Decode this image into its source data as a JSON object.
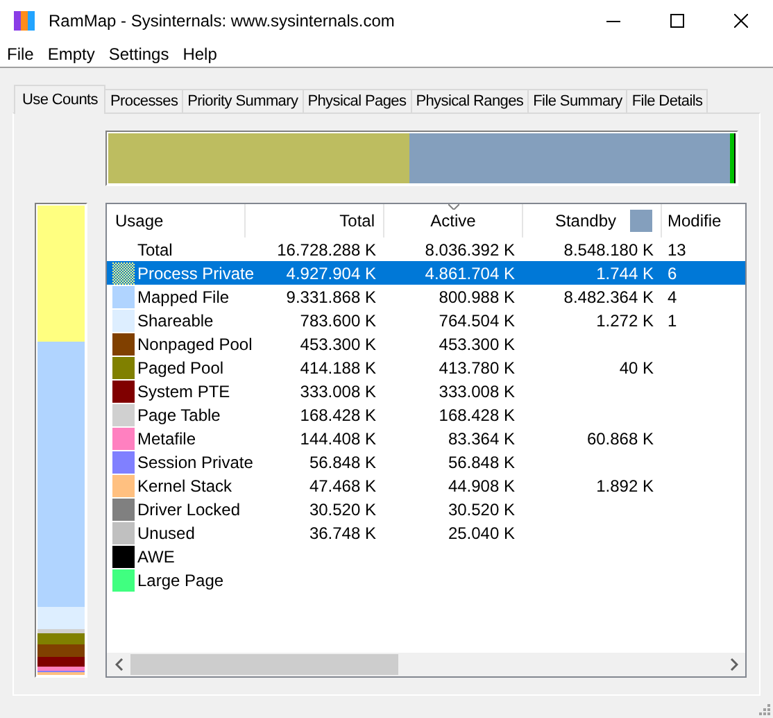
{
  "window": {
    "title": "RamMap - Sysinternals: www.sysinternals.com"
  },
  "menu": [
    "File",
    "Empty",
    "Settings",
    "Help"
  ],
  "tabs": [
    {
      "label": "Use Counts",
      "selected": true
    },
    {
      "label": "Processes",
      "selected": false
    },
    {
      "label": "Priority Summary",
      "selected": false
    },
    {
      "label": "Physical Pages",
      "selected": false
    },
    {
      "label": "Physical Ranges",
      "selected": false
    },
    {
      "label": "File Summary",
      "selected": false
    },
    {
      "label": "File Details",
      "selected": false
    }
  ],
  "table": {
    "columns": [
      {
        "label": "Usage",
        "sorted": false
      },
      {
        "label": "Total",
        "sorted": false
      },
      {
        "label": "Active",
        "sorted": true
      },
      {
        "label": "Standby",
        "sorted": false,
        "color": "#849fbd"
      },
      {
        "label": "Modifie",
        "sorted": false
      }
    ],
    "rows": [
      {
        "usage": "Total",
        "total": "16.728.288 K",
        "active": "8.036.392 K",
        "standby": "8.548.180 K",
        "modified": "13",
        "selected": false
      },
      {
        "usage": "Process Private",
        "color": "#ffff80",
        "total": "4.927.904 K",
        "active": "4.861.704 K",
        "standby": "1.744 K",
        "modified": "6",
        "selected": true
      },
      {
        "usage": "Mapped File",
        "color": "#b0d4ff",
        "total": "9.331.868 K",
        "active": "800.988 K",
        "standby": "8.482.364 K",
        "modified": "4",
        "selected": false
      },
      {
        "usage": "Shareable",
        "color": "#ddeeff",
        "total": "783.600 K",
        "active": "764.504 K",
        "standby": "1.272 K",
        "modified": "1",
        "selected": false
      },
      {
        "usage": "Nonpaged Pool",
        "color": "#804000",
        "total": "453.300 K",
        "active": "453.300 K",
        "selected": false
      },
      {
        "usage": "Paged Pool",
        "color": "#808000",
        "total": "414.188 K",
        "active": "413.780 K",
        "standby": "40 K",
        "selected": false
      },
      {
        "usage": "System PTE",
        "color": "#800000",
        "total": "333.008 K",
        "active": "333.008 K",
        "selected": false
      },
      {
        "usage": "Page Table",
        "color": "#d0d0d0",
        "total": "168.428 K",
        "active": "168.428 K",
        "selected": false
      },
      {
        "usage": "Metafile",
        "color": "#ff80c0",
        "total": "144.408 K",
        "active": "83.364 K",
        "standby": "60.868 K",
        "selected": false
      },
      {
        "usage": "Session Private",
        "color": "#8080ff",
        "total": "56.848 K",
        "active": "56.848 K",
        "selected": false
      },
      {
        "usage": "Kernel Stack",
        "color": "#ffc080",
        "total": "47.468 K",
        "active": "44.908 K",
        "standby": "1.892 K",
        "selected": false
      },
      {
        "usage": "Driver Locked",
        "color": "#808080",
        "total": "30.520 K",
        "active": "30.520 K",
        "selected": false
      },
      {
        "usage": "Unused",
        "color": "#c0c0c0",
        "total": "36.748 K",
        "active": "25.040 K",
        "selected": false
      },
      {
        "usage": "AWE",
        "color": "#000000",
        "selected": false
      },
      {
        "usage": "Large Page",
        "color": "#40ff80",
        "selected": false
      }
    ]
  }
}
